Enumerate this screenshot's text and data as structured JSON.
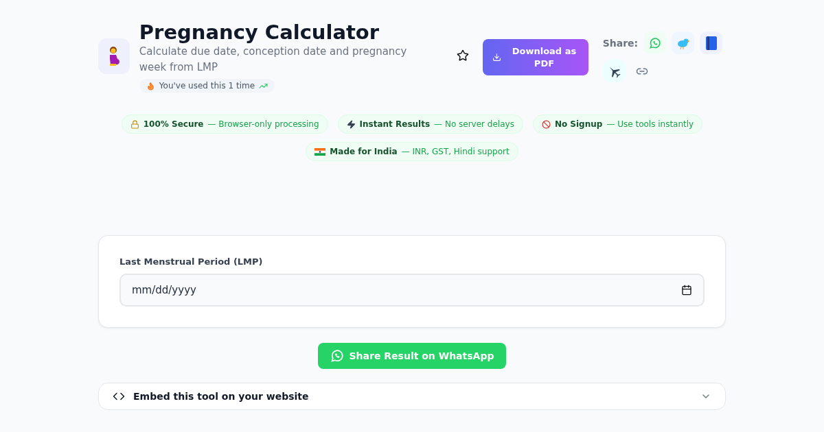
{
  "header": {
    "title": "Pregnancy Calculator",
    "subtitle": "Calculate due date, conception date and pregnancy week from LMP",
    "usage": "You've used this 1 time",
    "download_button": "Download as PDF",
    "share_label": "Share:"
  },
  "badges": [
    {
      "kind": "lock",
      "title": "100% Secure",
      "description": "— Browser-only processing"
    },
    {
      "kind": "bolt",
      "title": "Instant Results",
      "description": "— No server delays"
    },
    {
      "kind": "ban",
      "title": "No Signup",
      "description": "— Use tools instantly"
    },
    {
      "kind": "flag",
      "title": "Made for India",
      "description": "— INR, GST, Hindi support"
    }
  ],
  "form": {
    "label": "Last Menstrual Period (LMP)",
    "placeholder": "mm/dd/yyyy"
  },
  "whatsapp_button": "Share Result on WhatsApp",
  "embed": {
    "title": "Embed this tool on your website",
    "expanded": false
  }
}
